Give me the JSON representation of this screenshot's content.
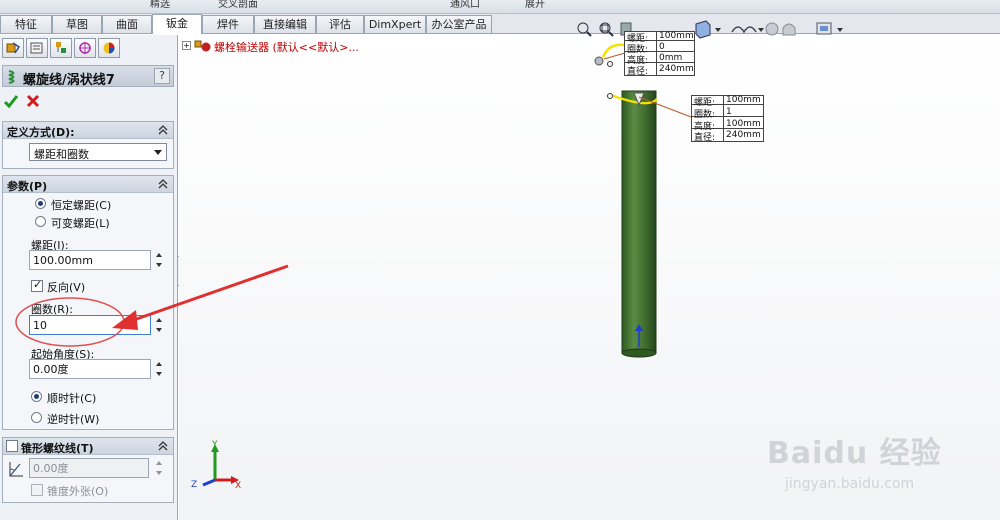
{
  "toolbar_top": {
    "items": [
      "精选",
      "交叉剖面",
      "通风口",
      "展开"
    ]
  },
  "tabs": [
    {
      "label": "特征",
      "active": false
    },
    {
      "label": "草图",
      "active": false
    },
    {
      "label": "曲面",
      "active": false
    },
    {
      "label": "钣金",
      "active": true
    },
    {
      "label": "焊件",
      "active": false
    },
    {
      "label": "直接编辑",
      "active": false
    },
    {
      "label": "评估",
      "active": false
    },
    {
      "label": "DimXpert",
      "active": false
    },
    {
      "label": "办公室产品",
      "active": false
    }
  ],
  "panel": {
    "feature_title": "螺旋线/涡状线7",
    "help_label": "?",
    "definition": {
      "header": "定义方式(D):",
      "selected": "螺距和圈数"
    },
    "parameters": {
      "header": "参数(P)",
      "constant_pitch": "恒定螺距(C)",
      "variable_pitch": "可变螺距(L)",
      "pitch_label": "螺距(I):",
      "pitch_value": "100.00mm",
      "reverse_label": "反向(V)",
      "revolutions_label": "圈数(R):",
      "revolutions_value": "10",
      "start_angle_label": "起始角度(S):",
      "start_angle_value": "0.00度",
      "clockwise": "顺时针(C)",
      "counterclockwise": "逆时针(W)"
    },
    "taper": {
      "header": "锥形螺纹线(T)",
      "angle_value": "0.00度",
      "taper_outward_label": "锥度外张(O)"
    }
  },
  "tree": {
    "label": "螺栓输送器 (默认<<默认>..."
  },
  "callout_top": {
    "rows": [
      {
        "k": "螺距:",
        "v": "100mm"
      },
      {
        "k": "圈数:",
        "v": "0"
      },
      {
        "k": "高度:",
        "v": "0mm"
      },
      {
        "k": "直径:",
        "v": "240mm"
      }
    ]
  },
  "callout_mid": {
    "rows": [
      {
        "k": "螺距:",
        "v": "100mm"
      },
      {
        "k": "圈数:",
        "v": "1"
      },
      {
        "k": "高度:",
        "v": "100mm"
      },
      {
        "k": "直径:",
        "v": "240mm"
      }
    ]
  },
  "triad": {
    "x": "X",
    "y": "Y",
    "z": "Z"
  },
  "watermark": {
    "brand": "Baidu 经验",
    "url": "jingyan.baidu.com"
  },
  "colors": {
    "cylinder": "#3f6b2e",
    "accent_red": "#e03030",
    "helix_yellow": "#f2e400"
  }
}
